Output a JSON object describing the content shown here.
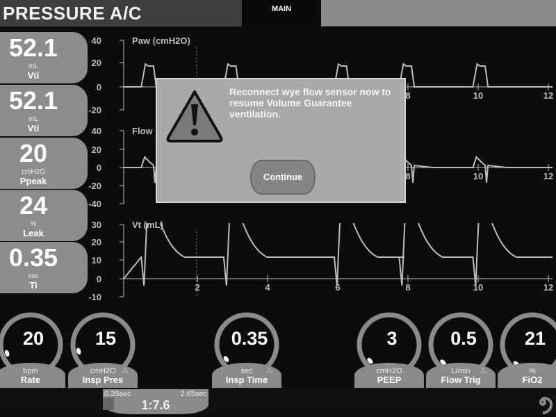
{
  "header": {
    "mode": "PRESSURE A/C",
    "tab": "MAIN"
  },
  "monitors": [
    {
      "value": "52.1",
      "unit": "mL",
      "name": "Vti"
    },
    {
      "value": "52.1",
      "unit": "mL",
      "name": "Vti"
    },
    {
      "value": "20",
      "unit": "cmH2O",
      "name": "Ppeak"
    },
    {
      "value": "24",
      "unit": "%",
      "name": "Leak"
    },
    {
      "value": "0.35",
      "unit": "sec",
      "name": "Ti"
    }
  ],
  "charts": [
    {
      "title": "Paw (cmH2O)",
      "yticks": [
        "40",
        "20",
        "0",
        "-20"
      ]
    },
    {
      "title": "Flow",
      "yticks": [
        "40",
        "20",
        "0",
        "-20",
        "-40"
      ]
    },
    {
      "title": "Vt (mL)",
      "yticks": [
        "30",
        "20",
        "10",
        "0",
        "-10"
      ]
    }
  ],
  "time_ticks": [
    "2",
    "4",
    "6",
    "8",
    "10",
    "12"
  ],
  "dialog": {
    "message": "Reconnect wye flow sensor now to resume Volume Guarantee ventilation.",
    "button": "Continue",
    "icon": "warning-icon"
  },
  "settings": [
    {
      "value": "20",
      "unit": "bpm",
      "name": "Rate",
      "warn": false
    },
    {
      "value": "15",
      "unit": "cmH2O",
      "name": "Insp Pres",
      "warn": true
    },
    {
      "value": "0.35",
      "unit": "sec",
      "name": "Insp Time",
      "warn": true
    },
    {
      "value": "3",
      "unit": "cmH2O",
      "name": "PEEP",
      "warn": false
    },
    {
      "value": "0.5",
      "unit": "L/min",
      "name": "Flow Trig",
      "warn": true
    },
    {
      "value": "21",
      "unit": "%",
      "name": "FiO2",
      "warn": false
    }
  ],
  "warn_symbol": "△",
  "ie_ratio": {
    "insp": "0.35sec",
    "exp": "2.65sec",
    "ratio": "1:7.6"
  },
  "colors": {
    "panel": "#8c8c8c",
    "background": "#0c0c0c",
    "dialog": "#a9a9a9",
    "trace": "#bdbdbd"
  }
}
